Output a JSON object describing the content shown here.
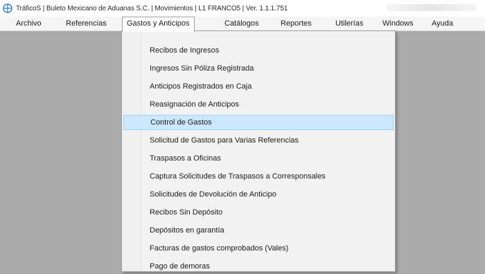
{
  "window": {
    "title": "TráficoS | Buleto Mexicano de Aduanas S.C. | Movimientos | L1 FRANCO5 | Ver. 1.1.1.751"
  },
  "colors": {
    "workspace": "#ababab",
    "highlight": "#cce8ff",
    "highlight_border": "#99d1ff",
    "icon_accent": "#2f7bc4"
  },
  "menubar": {
    "items": [
      {
        "label": "Archivo"
      },
      {
        "label": "Referencias"
      },
      {
        "label": "Gastos y Anticipos"
      },
      {
        "label": "Catálogos"
      },
      {
        "label": "Reportes"
      },
      {
        "label": "Utilerías"
      },
      {
        "label": "Windows"
      },
      {
        "label": "Ayuda"
      }
    ],
    "open_item": "Gastos y Anticipos"
  },
  "dropdown": {
    "items": [
      {
        "label": "Recibos de Ingresos"
      },
      {
        "label": "Ingresos Sin Póliza Registrada"
      },
      {
        "label": "Anticipos Registrados en Caja"
      },
      {
        "label": "Reasignación de Anticipos"
      },
      {
        "label": "Control de Gastos",
        "highlighted": true
      },
      {
        "label": "Solicitud de Gastos para Varias Referencias"
      },
      {
        "label": "Traspasos a Oficinas"
      },
      {
        "label": "Captura Solicitudes de Traspasos a Corresponsales"
      },
      {
        "label": "Solicitudes de Devolución de Anticipo"
      },
      {
        "label": "Recibos Sin Depósito"
      },
      {
        "label": "Depósitos en garantía"
      },
      {
        "label": "Facturas de gastos comprobados (Vales)"
      },
      {
        "label": "Pago de demoras"
      }
    ]
  }
}
